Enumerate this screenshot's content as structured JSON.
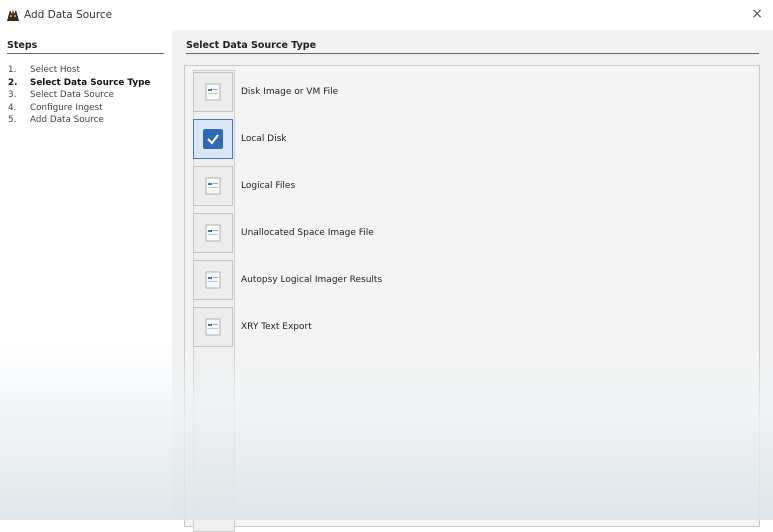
{
  "window": {
    "title": "Add Data Source",
    "close_glyph": "×"
  },
  "steps": {
    "heading": "Steps",
    "current_index": 1,
    "items": [
      {
        "number": "1.",
        "label": "Select Host"
      },
      {
        "number": "2.",
        "label": "Select Data Source Type"
      },
      {
        "number": "3.",
        "label": "Select Data Source"
      },
      {
        "number": "4.",
        "label": "Configure Ingest"
      },
      {
        "number": "5.",
        "label": "Add Data Source"
      }
    ]
  },
  "main": {
    "heading": "Select Data Source Type",
    "selected_option": "Local Disk",
    "options": [
      {
        "label": "Disk Image or VM File",
        "icon": "document-icon"
      },
      {
        "label": "Local Disk",
        "icon": "checkbox-checked-icon"
      },
      {
        "label": "Logical Files",
        "icon": "document-icon"
      },
      {
        "label": "Unallocated Space Image File",
        "icon": "document-icon"
      },
      {
        "label": "Autopsy Logical Imager Results",
        "icon": "document-icon"
      },
      {
        "label": "XRY Text Export",
        "icon": "document-icon"
      }
    ]
  },
  "colors": {
    "accent": "#2f6bb5",
    "panel_bg": "#f2f2f2"
  }
}
